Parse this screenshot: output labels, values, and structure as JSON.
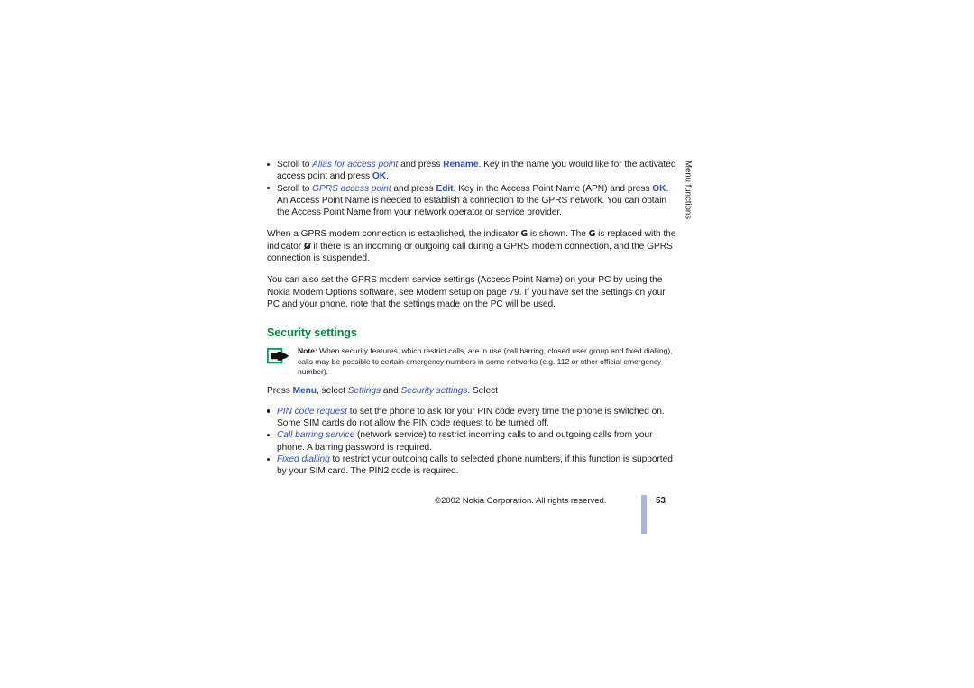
{
  "document": {
    "title": "Nokia phone user guide page",
    "background_color": "#ffffff",
    "accent_green": "#008a3c",
    "accent_blue": "#2b4fc4",
    "footer_bar_color": "#aab4de"
  },
  "side_tab": {
    "label": "Menu functions"
  },
  "bullets_top": [
    {
      "parts": {
        "t1": "Scroll to ",
        "i1": "Alias for access point",
        "t2": " and press ",
        "b1": "Rename",
        "t3": ". Key in the name you would like for the activated access point and press ",
        "b2": "OK",
        "t4": "."
      }
    },
    {
      "parts": {
        "t1": "Scroll to ",
        "i1": "GPRS access point",
        "t2": " and press ",
        "b1": "Edit",
        "t3": ". Key in the Access Point Name (APN) and press ",
        "b2": "OK",
        "t4": "."
      },
      "sub_paragraph": "An Access Point Name is needed to establish a connection to the GPRS network. You can obtain the Access Point Name from your network operator or service provider."
    }
  ],
  "paragraphs": {
    "gprs_indicator": {
      "t1": "When a GPRS modem connection is established, the indicator ",
      "glyph1": "G",
      "t2": " is shown. The ",
      "glyph2": "G",
      "t3": " is replaced with the indicator ",
      "glyph3": "G",
      "t4": " if there is an incoming or outgoing call during a GPRS modem connection, and the GPRS connection is suspended."
    },
    "pc_settings": "You can also set the GPRS modem service settings (Access Point Name) on your PC by using the Nokia Modem Options software, see Modem setup on page 79. If you have set the settings on your PC and your phone, note that the settings made on the PC will be used."
  },
  "section": {
    "heading": "Security settings"
  },
  "note": {
    "icon_name": "note-hand-icon",
    "label": "Note:",
    "text": " When security features, which restrict calls, are in use (call barring, closed user group and fixed dialling), calls may be possible to certain emergency numbers in some networks (e.g.  112 or other official emergency number)."
  },
  "press_line": {
    "t1": "Press ",
    "b1": "Menu",
    "t2": ", select ",
    "i1": "Settings",
    "t3": " and ",
    "i2": "Security settings",
    "t4": ". Select"
  },
  "bullets_bottom": [
    {
      "term": "PIN code request",
      "text": " to set the phone to ask for your PIN code every time the phone is switched on. Some SIM cards do not allow the PIN code request to be turned off."
    },
    {
      "term": "Call barring service",
      "text": " (network service) to restrict incoming calls to and outgoing calls from your phone. A barring password is required."
    },
    {
      "term": "Fixed dialling",
      "text": " to restrict your outgoing calls to selected phone numbers, if this function is supported by your SIM card. The PIN2 code is required."
    }
  ],
  "footer": {
    "copyright": "©2002 Nokia Corporation. All rights reserved.",
    "page_number": "53"
  }
}
